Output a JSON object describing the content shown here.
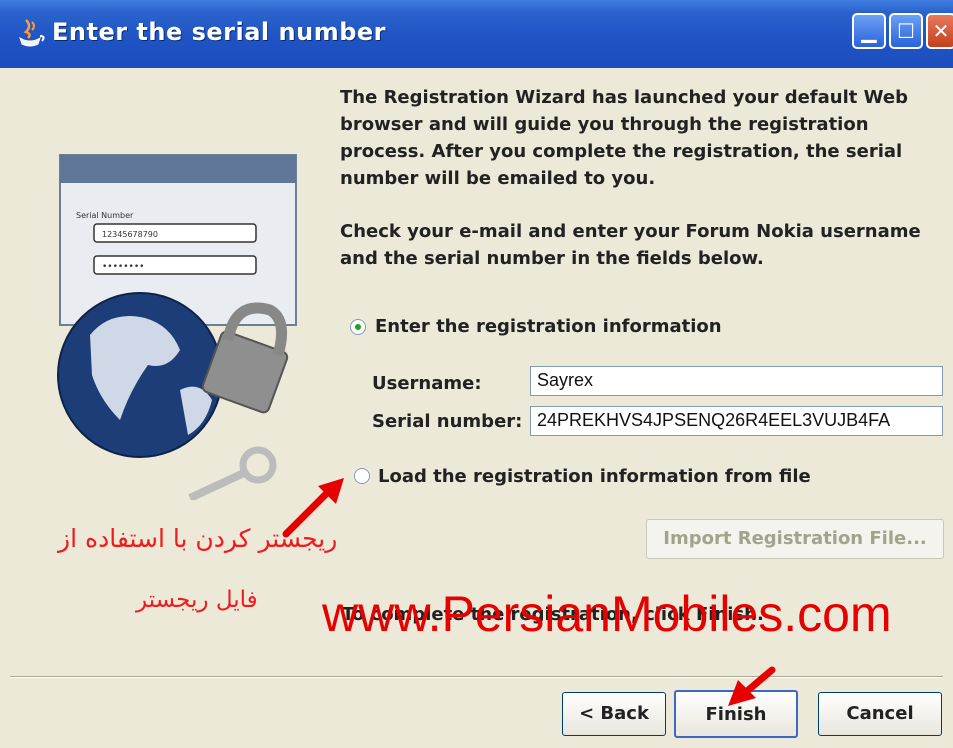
{
  "window": {
    "title": "Enter the serial number",
    "controls": [
      "minimize",
      "maximize",
      "close"
    ]
  },
  "intro_text": "The Registration Wizard has launched your default Web browser and will guide you through the registration process. After you complete the registration, the serial number will be emailed to you.",
  "instruction_text": "Check your e-mail and enter your Forum Nokia username and the serial number in the fields below.",
  "options": {
    "enter_info": {
      "label": "Enter the registration information",
      "selected": true
    },
    "load_file": {
      "label": "Load the registration information from file",
      "selected": false
    }
  },
  "form": {
    "username_label": "Username:",
    "username_value": "Sayrex",
    "serial_label": "Serial number:",
    "serial_value": "24PREKHVS4JPSENQ26R4EEL3VUJB4FA"
  },
  "import_button": {
    "label": "Import Registration File...",
    "enabled": false
  },
  "finish_message": "To complete the registration, click Finish.",
  "illustration": {
    "serial_label": "Serial Number",
    "serial_value": "12345678790",
    "password_mask": "••••••••"
  },
  "buttons": {
    "back": "< Back",
    "finish": "Finish",
    "cancel": "Cancel"
  },
  "overlay": {
    "watermark": "www.PersianMobiles.com",
    "persian_line1": "ریجستر کردن با استفاده از",
    "persian_line2": "فایل ریجستر"
  },
  "colors": {
    "titlebar": "#1f53c4",
    "dialog_bg": "#ece9d8",
    "watermark": "#e60000",
    "arrow": "#e60000"
  }
}
